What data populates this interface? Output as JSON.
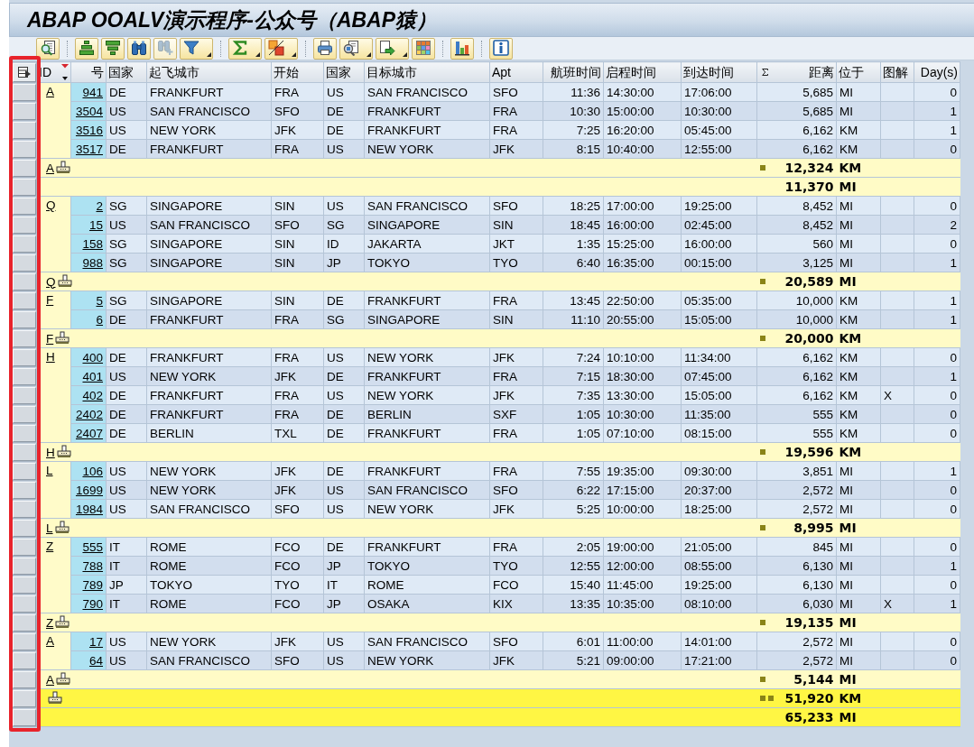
{
  "window": {
    "title": "ABAP OOALV演示程序-公众号（ABAP猿）"
  },
  "toolbar": {
    "groups": [
      [
        {
          "kind": "details",
          "dropdown": false,
          "disabled": false
        }
      ],
      [
        {
          "kind": "sort_ascending",
          "dropdown": false,
          "disabled": false
        },
        {
          "kind": "sort_descending",
          "dropdown": false,
          "disabled": false
        },
        {
          "kind": "find",
          "dropdown": false,
          "disabled": false
        },
        {
          "kind": "find_next",
          "dropdown": false,
          "disabled": true
        },
        {
          "kind": "filter",
          "dropdown": true,
          "disabled": false
        }
      ],
      [
        {
          "kind": "sum",
          "dropdown": true,
          "disabled": false
        },
        {
          "kind": "subtotals",
          "dropdown": true,
          "disabled": false
        }
      ],
      [
        {
          "kind": "print",
          "dropdown": false,
          "disabled": false
        },
        {
          "kind": "views",
          "dropdown": true,
          "disabled": false
        },
        {
          "kind": "export",
          "dropdown": true,
          "disabled": false
        },
        {
          "kind": "layout",
          "dropdown": false,
          "disabled": false
        }
      ],
      [
        {
          "kind": "chart",
          "dropdown": false,
          "disabled": false
        }
      ],
      [
        {
          "kind": "info",
          "dropdown": false,
          "disabled": false
        }
      ]
    ]
  },
  "table": {
    "row_selector_highlighted": true,
    "columns": [
      {
        "label": "ID",
        "kind": "group",
        "sorted": true,
        "summed": false
      },
      {
        "label": "号",
        "kind": "key",
        "sorted": false,
        "summed": false
      },
      {
        "label": "国家",
        "kind": "text",
        "sorted": false,
        "summed": false
      },
      {
        "label": "起飞城市",
        "kind": "text",
        "sorted": false,
        "summed": false
      },
      {
        "label": "开始",
        "kind": "text",
        "sorted": false,
        "summed": false
      },
      {
        "label": "国家",
        "kind": "text",
        "sorted": false,
        "summed": false
      },
      {
        "label": "目标城市",
        "kind": "text",
        "sorted": false,
        "summed": false
      },
      {
        "label": "Apt",
        "kind": "text",
        "sorted": false,
        "summed": false
      },
      {
        "label": "航班时间",
        "kind": "number",
        "sorted": false,
        "summed": false
      },
      {
        "label": "启程时间",
        "kind": "text",
        "sorted": false,
        "summed": false
      },
      {
        "label": "到达时间",
        "kind": "text",
        "sorted": false,
        "summed": false
      },
      {
        "label": "距离",
        "kind": "quantity",
        "sorted": false,
        "summed": true
      },
      {
        "label": "位于",
        "kind": "unit",
        "sorted": false,
        "summed": false
      },
      {
        "label": "图解",
        "kind": "flag",
        "sorted": false,
        "summed": false
      },
      {
        "label": "Day(s)",
        "kind": "number",
        "sorted": false,
        "summed": false
      }
    ],
    "groups": [
      {
        "carrier": "A",
        "rows": [
          [
            "941",
            "DE",
            "FRANKFURT",
            "FRA",
            "US",
            "SAN FRANCISCO",
            "SFO",
            "11:36",
            "14:30:00",
            "17:06:00",
            "5,685",
            "MI",
            null,
            "0"
          ],
          [
            "3504",
            "US",
            "SAN FRANCISCO",
            "SFO",
            "DE",
            "FRANKFURT",
            "FRA",
            "10:30",
            "15:00:00",
            "10:30:00",
            "5,685",
            "MI",
            null,
            "1"
          ],
          [
            "3516",
            "US",
            "NEW YORK",
            "JFK",
            "DE",
            "FRANKFURT",
            "FRA",
            "7:25",
            "16:20:00",
            "05:45:00",
            "6,162",
            "KM",
            null,
            "1"
          ],
          [
            "3517",
            "DE",
            "FRANKFURT",
            "FRA",
            "US",
            "NEW YORK",
            "JFK",
            "8:15",
            "10:40:00",
            "12:55:00",
            "6,162",
            "KM",
            null,
            "0"
          ]
        ],
        "subtotals": {
          "label": "A",
          "lines": [
            {
              "value": "12,324",
              "unit": "KM"
            },
            {
              "value": "11,370",
              "unit": "MI"
            }
          ]
        }
      },
      {
        "carrier": "Q",
        "rows": [
          [
            "2",
            "SG",
            "SINGAPORE",
            "SIN",
            "US",
            "SAN FRANCISCO",
            "SFO",
            "18:25",
            "17:00:00",
            "19:25:00",
            "8,452",
            "MI",
            null,
            "0"
          ],
          [
            "15",
            "US",
            "SAN FRANCISCO",
            "SFO",
            "SG",
            "SINGAPORE",
            "SIN",
            "18:45",
            "16:00:00",
            "02:45:00",
            "8,452",
            "MI",
            null,
            "2"
          ],
          [
            "158",
            "SG",
            "SINGAPORE",
            "SIN",
            "ID",
            "JAKARTA",
            "JKT",
            "1:35",
            "15:25:00",
            "16:00:00",
            "560",
            "MI",
            null,
            "0"
          ],
          [
            "988",
            "SG",
            "SINGAPORE",
            "SIN",
            "JP",
            "TOKYO",
            "TYO",
            "6:40",
            "16:35:00",
            "00:15:00",
            "3,125",
            "MI",
            null,
            "1"
          ]
        ],
        "subtotals": {
          "label": "Q",
          "lines": [
            {
              "value": "20,589",
              "unit": "MI"
            }
          ]
        }
      },
      {
        "carrier": "F",
        "rows": [
          [
            "5",
            "SG",
            "SINGAPORE",
            "SIN",
            "DE",
            "FRANKFURT",
            "FRA",
            "13:45",
            "22:50:00",
            "05:35:00",
            "10,000",
            "KM",
            null,
            "1"
          ],
          [
            "6",
            "DE",
            "FRANKFURT",
            "FRA",
            "SG",
            "SINGAPORE",
            "SIN",
            "11:10",
            "20:55:00",
            "15:05:00",
            "10,000",
            "KM",
            null,
            "1"
          ]
        ],
        "subtotals": {
          "label": "F",
          "lines": [
            {
              "value": "20,000",
              "unit": "KM"
            }
          ]
        }
      },
      {
        "carrier": "H",
        "rows": [
          [
            "400",
            "DE",
            "FRANKFURT",
            "FRA",
            "US",
            "NEW YORK",
            "JFK",
            "7:24",
            "10:10:00",
            "11:34:00",
            "6,162",
            "KM",
            null,
            "0"
          ],
          [
            "401",
            "US",
            "NEW YORK",
            "JFK",
            "DE",
            "FRANKFURT",
            "FRA",
            "7:15",
            "18:30:00",
            "07:45:00",
            "6,162",
            "KM",
            null,
            "1"
          ],
          [
            "402",
            "DE",
            "FRANKFURT",
            "FRA",
            "US",
            "NEW YORK",
            "JFK",
            "7:35",
            "13:30:00",
            "15:05:00",
            "6,162",
            "KM",
            "X",
            "0"
          ],
          [
            "2402",
            "DE",
            "FRANKFURT",
            "FRA",
            "DE",
            "BERLIN",
            "SXF",
            "1:05",
            "10:30:00",
            "11:35:00",
            "555",
            "KM",
            null,
            "0"
          ],
          [
            "2407",
            "DE",
            "BERLIN",
            "TXL",
            "DE",
            "FRANKFURT",
            "FRA",
            "1:05",
            "07:10:00",
            "08:15:00",
            "555",
            "KM",
            null,
            "0"
          ]
        ],
        "subtotals": {
          "label": "H",
          "lines": [
            {
              "value": "19,596",
              "unit": "KM"
            }
          ]
        }
      },
      {
        "carrier": "L",
        "rows": [
          [
            "106",
            "US",
            "NEW YORK",
            "JFK",
            "DE",
            "FRANKFURT",
            "FRA",
            "7:55",
            "19:35:00",
            "09:30:00",
            "3,851",
            "MI",
            null,
            "1"
          ],
          [
            "1699",
            "US",
            "NEW YORK",
            "JFK",
            "US",
            "SAN FRANCISCO",
            "SFO",
            "6:22",
            "17:15:00",
            "20:37:00",
            "2,572",
            "MI",
            null,
            "0"
          ],
          [
            "1984",
            "US",
            "SAN FRANCISCO",
            "SFO",
            "US",
            "NEW YORK",
            "JFK",
            "5:25",
            "10:00:00",
            "18:25:00",
            "2,572",
            "MI",
            null,
            "0"
          ]
        ],
        "subtotals": {
          "label": "L",
          "lines": [
            {
              "value": "8,995",
              "unit": "MI"
            }
          ]
        }
      },
      {
        "carrier": "Z",
        "rows": [
          [
            "555",
            "IT",
            "ROME",
            "FCO",
            "DE",
            "FRANKFURT",
            "FRA",
            "2:05",
            "19:00:00",
            "21:05:00",
            "845",
            "MI",
            null,
            "0"
          ],
          [
            "788",
            "IT",
            "ROME",
            "FCO",
            "JP",
            "TOKYO",
            "TYO",
            "12:55",
            "12:00:00",
            "08:55:00",
            "6,130",
            "MI",
            null,
            "1"
          ],
          [
            "789",
            "JP",
            "TOKYO",
            "TYO",
            "IT",
            "ROME",
            "FCO",
            "15:40",
            "11:45:00",
            "19:25:00",
            "6,130",
            "MI",
            null,
            "0"
          ],
          [
            "790",
            "IT",
            "ROME",
            "FCO",
            "JP",
            "OSAKA",
            "KIX",
            "13:35",
            "10:35:00",
            "08:10:00",
            "6,030",
            "MI",
            "X",
            "1"
          ]
        ],
        "subtotals": {
          "label": "Z",
          "lines": [
            {
              "value": "19,135",
              "unit": "MI"
            }
          ]
        }
      },
      {
        "carrier": "A",
        "rows": [
          [
            "17",
            "US",
            "NEW YORK",
            "JFK",
            "US",
            "SAN FRANCISCO",
            "SFO",
            "6:01",
            "11:00:00",
            "14:01:00",
            "2,572",
            "MI",
            null,
            "0"
          ],
          [
            "64",
            "US",
            "SAN FRANCISCO",
            "SFO",
            "US",
            "NEW YORK",
            "JFK",
            "5:21",
            "09:00:00",
            "17:21:00",
            "2,572",
            "MI",
            null,
            "0"
          ]
        ],
        "subtotals": {
          "label": "A",
          "lines": [
            {
              "value": "5,144",
              "unit": "MI"
            }
          ]
        }
      }
    ],
    "grand_total": {
      "lines": [
        {
          "value": "51,920",
          "unit": "KM"
        },
        {
          "value": "65,233",
          "unit": "MI"
        }
      ]
    }
  }
}
